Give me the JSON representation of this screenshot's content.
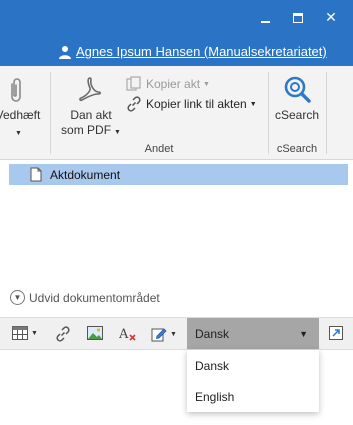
{
  "window": {
    "user_name": "Agnes Ipsum Hansen (Manualsekretariatet)"
  },
  "ribbon": {
    "attach_label": "Vedhæft",
    "pdf_label_line1": "Dan akt",
    "pdf_label_line2": "som PDF",
    "copy_act_label": "Kopier akt",
    "copy_link_label": "Kopier link til akten",
    "group_andet": "Andet",
    "csearch_label": "cSearch",
    "group_csearch": "cSearch"
  },
  "documents": {
    "items": [
      {
        "label": "Aktdokument"
      }
    ],
    "expand_label": "Udvid dokumentområdet"
  },
  "editor": {
    "language_selected": "Dansk",
    "language_options": [
      "Dansk",
      "English"
    ]
  },
  "colors": {
    "titlebar": "#2b73c4",
    "selection": "#a9c8ee",
    "language_select_bg": "#a6a6a6"
  }
}
